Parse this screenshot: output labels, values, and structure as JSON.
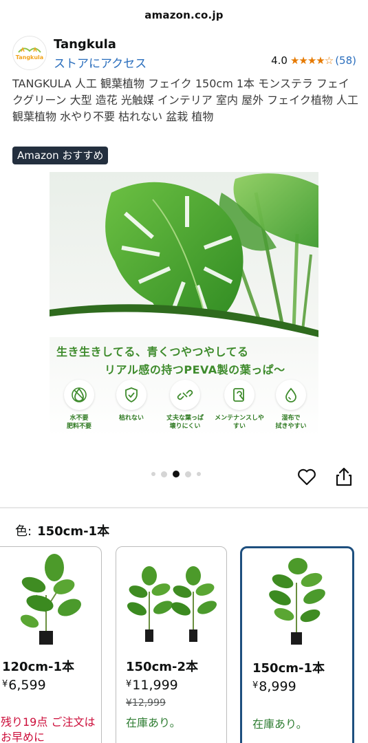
{
  "browser": {
    "url": "amazon.co.jp"
  },
  "brand": {
    "logo_text": "Tangkula",
    "name": "Tangkula",
    "store_link": "ストアにアクセス",
    "rating": "4.0",
    "stars": "★★★★☆",
    "review_count": "(58)"
  },
  "product": {
    "title": "TANGKULA 人工 観葉植物 フェイク 150cm 1本 モンステラ フェイクグリーン 大型 造花 光触媒 インテリア 室内 屋外 フェイク植物 人工観葉植物 水やり不要 枯れない 盆栽 植物",
    "badge": "Amazon おすすめ"
  },
  "hero": {
    "headline1": "生き生きしてる、青くつやつやしてる",
    "headline2": "リアル感の持つPEVA製の葉っぱ～",
    "features": [
      {
        "icon": "no-water-icon",
        "label": "水不要\n肥料不要"
      },
      {
        "icon": "shield-check-icon",
        "label": "枯れない"
      },
      {
        "icon": "broken-link-icon",
        "label": "丈夫な葉っぱ\n壊りにくい"
      },
      {
        "icon": "maintenance-icon",
        "label": "メンテナンスしやすい"
      },
      {
        "icon": "water-drop-icon",
        "label": "湿布で\n拭きやすい"
      }
    ],
    "carousel_total": 5,
    "carousel_active": 3
  },
  "color_select": {
    "label": "色:",
    "selected": "150cm-1本"
  },
  "variants": [
    {
      "name": "120cm-1本",
      "currency": "¥",
      "price": "6,599",
      "old_price": "",
      "stock": "",
      "low_stock": "残り19点 ご注文はお早めに",
      "selected": false
    },
    {
      "name": "150cm-2本",
      "currency": "¥",
      "price": "11,999",
      "old_price": "¥12,999",
      "stock": "在庫あり。",
      "low_stock": "",
      "selected": false
    },
    {
      "name": "150cm-1本",
      "currency": "¥",
      "price": "8,999",
      "old_price": "",
      "stock": "在庫あり。",
      "low_stock": "",
      "selected": true
    }
  ],
  "colors": {
    "link": "#2a6ebd",
    "star": "#e67a00",
    "in_stock": "#2e7d32",
    "low_stock": "#cc0c39",
    "selected_border": "#1e4f7e",
    "badge_bg": "#232f3e",
    "hero_text": "#3e8b2c"
  }
}
